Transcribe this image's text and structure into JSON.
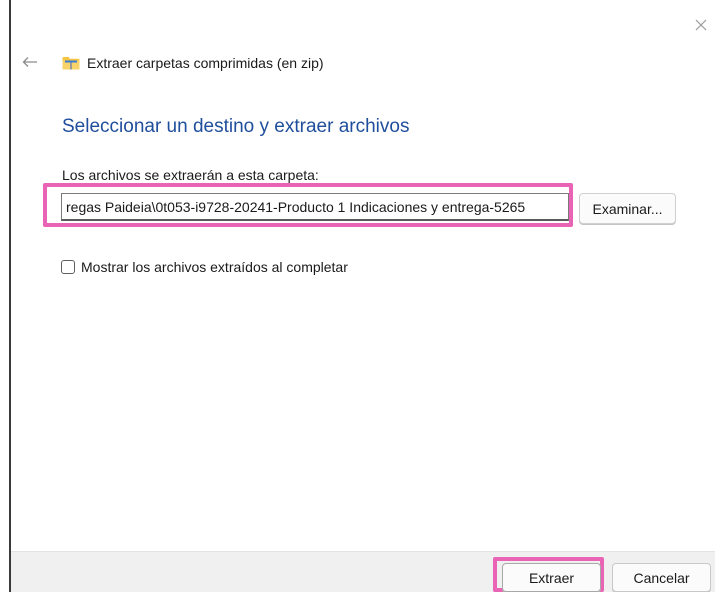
{
  "window": {
    "title": "Extraer carpetas comprimidas (en zip)",
    "title_icon": "zip-folder-icon",
    "close_icon": "close-icon",
    "back_icon": "arrow-left-icon"
  },
  "main": {
    "heading": "Seleccionar un destino y extraer archivos",
    "destination_label": "Los archivos se extraerán a esta carpeta:",
    "destination_value": "regas Paideia\\0t053-i9728-20241-Producto 1 Indicaciones y entrega-5265",
    "browse_label": "Examinar...",
    "show_files_label": "Mostrar los archivos extraídos al completar",
    "show_files_checked": false
  },
  "footer": {
    "extract_label": "Extraer",
    "cancel_label": "Cancelar"
  },
  "colors": {
    "heading": "#1f4e9c",
    "highlight": "#e964b4",
    "footer_bg": "#f0f0f0",
    "folder_yellow": "#f4c542"
  }
}
